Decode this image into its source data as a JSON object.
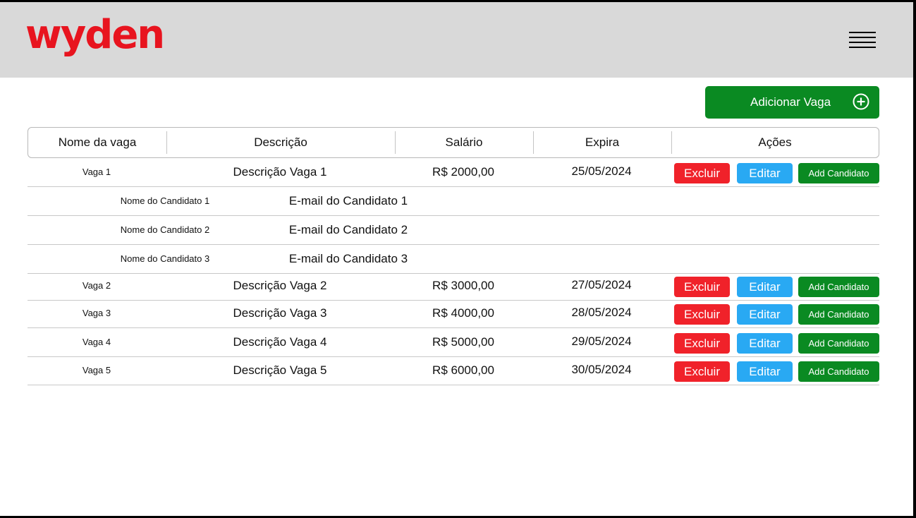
{
  "header": {
    "logo_text": "wyden",
    "menu_icon": "hamburger-menu-icon"
  },
  "toolbar": {
    "add_vaga_label": "Adicionar Vaga",
    "add_vaga_icon": "plus-circle-icon"
  },
  "table": {
    "columns": [
      "Nome da vaga",
      "Descrição",
      "Salário",
      "Expira",
      "Ações"
    ],
    "actions": {
      "delete_label": "Excluir",
      "edit_label": "Editar",
      "add_candidate_label": "Add Candidato"
    },
    "vagas": [
      {
        "name": "Vaga 1",
        "description": "Descrição Vaga 1",
        "salary": "R$ 2000,00",
        "expires": "25/05/2024",
        "candidates": [
          {
            "name": "Nome do Candidato 1",
            "email": "E-mail do Candidato 1"
          },
          {
            "name": "Nome do Candidato 2",
            "email": "E-mail do Candidato 2"
          },
          {
            "name": "Nome do Candidato 3",
            "email": "E-mail do Candidato 3"
          }
        ]
      },
      {
        "name": "Vaga 2",
        "description": "Descrição Vaga 2",
        "salary": "R$ 3000,00",
        "expires": "27/05/2024"
      },
      {
        "name": "Vaga 3",
        "description": "Descrição Vaga 3",
        "salary": "R$ 4000,00",
        "expires": "28/05/2024"
      },
      {
        "name": "Vaga 4",
        "description": "Descrição Vaga 4",
        "salary": "R$ 5000,00",
        "expires": "29/05/2024"
      },
      {
        "name": "Vaga 5",
        "description": "Descrição Vaga 5",
        "salary": "R$ 6000,00",
        "expires": "30/05/2024"
      }
    ]
  },
  "colors": {
    "brand_red": "#e8141f",
    "header_bg": "#d9d9d9",
    "success_green": "#0a8a22",
    "danger_red": "#f0222a",
    "info_blue": "#29a9f3"
  }
}
